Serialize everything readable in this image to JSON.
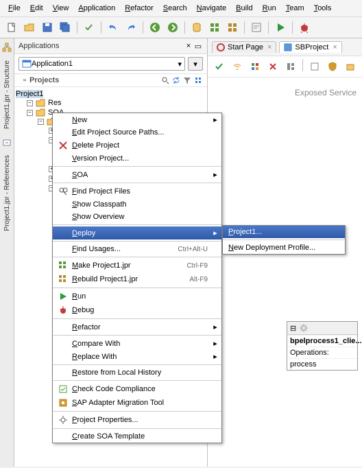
{
  "menubar": [
    "File",
    "Edit",
    "View",
    "Application",
    "Refactor",
    "Search",
    "Navigate",
    "Build",
    "Run",
    "Team",
    "Tools"
  ],
  "applications_panel": {
    "title": "Applications",
    "selected": "Application1",
    "projects_label": "Projects",
    "tree_root": "Project1",
    "tree_items": [
      "Res",
      "SOA"
    ]
  },
  "side_tabs": [
    "Project1.jpr - Structure",
    "Project1.jpr - References"
  ],
  "main_tabs": [
    {
      "icon": "start",
      "label": "Start Page"
    },
    {
      "icon": "sb",
      "label": "SBProject"
    }
  ],
  "canvas_title": "Exposed Service",
  "component": {
    "title": "bpelprocess1_clie...",
    "op_label": "Operations:",
    "op": "process"
  },
  "context_menu": [
    {
      "type": "item",
      "label": "New",
      "submenu": true
    },
    {
      "type": "item",
      "label": "Edit Project Source Paths..."
    },
    {
      "type": "item",
      "icon": "delete",
      "label": "Delete Project"
    },
    {
      "type": "item",
      "label": "Version Project..."
    },
    {
      "type": "sep"
    },
    {
      "type": "item",
      "label": "SOA",
      "submenu": true
    },
    {
      "type": "sep"
    },
    {
      "type": "item",
      "icon": "find",
      "label": "Find Project Files"
    },
    {
      "type": "item",
      "label": "Show Classpath"
    },
    {
      "type": "item",
      "label": "Show Overview"
    },
    {
      "type": "sep"
    },
    {
      "type": "item",
      "label": "Deploy",
      "submenu": true,
      "selected": true
    },
    {
      "type": "sep"
    },
    {
      "type": "item",
      "label": "Find Usages...",
      "shortcut": "Ctrl+Alt-U"
    },
    {
      "type": "sep"
    },
    {
      "type": "item",
      "icon": "make",
      "label": "Make Project1.jpr",
      "shortcut": "Ctrl-F9"
    },
    {
      "type": "item",
      "icon": "rebuild",
      "label": "Rebuild Project1.jpr",
      "shortcut": "Alt-F9"
    },
    {
      "type": "sep"
    },
    {
      "type": "item",
      "icon": "run",
      "label": "Run"
    },
    {
      "type": "item",
      "icon": "debug",
      "label": "Debug"
    },
    {
      "type": "sep"
    },
    {
      "type": "item",
      "label": "Refactor",
      "submenu": true
    },
    {
      "type": "sep"
    },
    {
      "type": "item",
      "label": "Compare With",
      "submenu": true
    },
    {
      "type": "item",
      "label": "Replace With",
      "submenu": true
    },
    {
      "type": "sep"
    },
    {
      "type": "item",
      "label": "Restore from Local History"
    },
    {
      "type": "sep"
    },
    {
      "type": "item",
      "icon": "check",
      "label": "Check Code Compliance"
    },
    {
      "type": "item",
      "icon": "migrate",
      "label": "SAP Adapter Migration Tool"
    },
    {
      "type": "sep"
    },
    {
      "type": "item",
      "icon": "props",
      "label": "Project Properties..."
    },
    {
      "type": "sep"
    },
    {
      "type": "item",
      "label": "Create SOA Template"
    }
  ],
  "deploy_submenu": [
    {
      "label": "Project1...",
      "selected": true
    },
    {
      "type": "sep"
    },
    {
      "label": "New Deployment Profile..."
    }
  ]
}
